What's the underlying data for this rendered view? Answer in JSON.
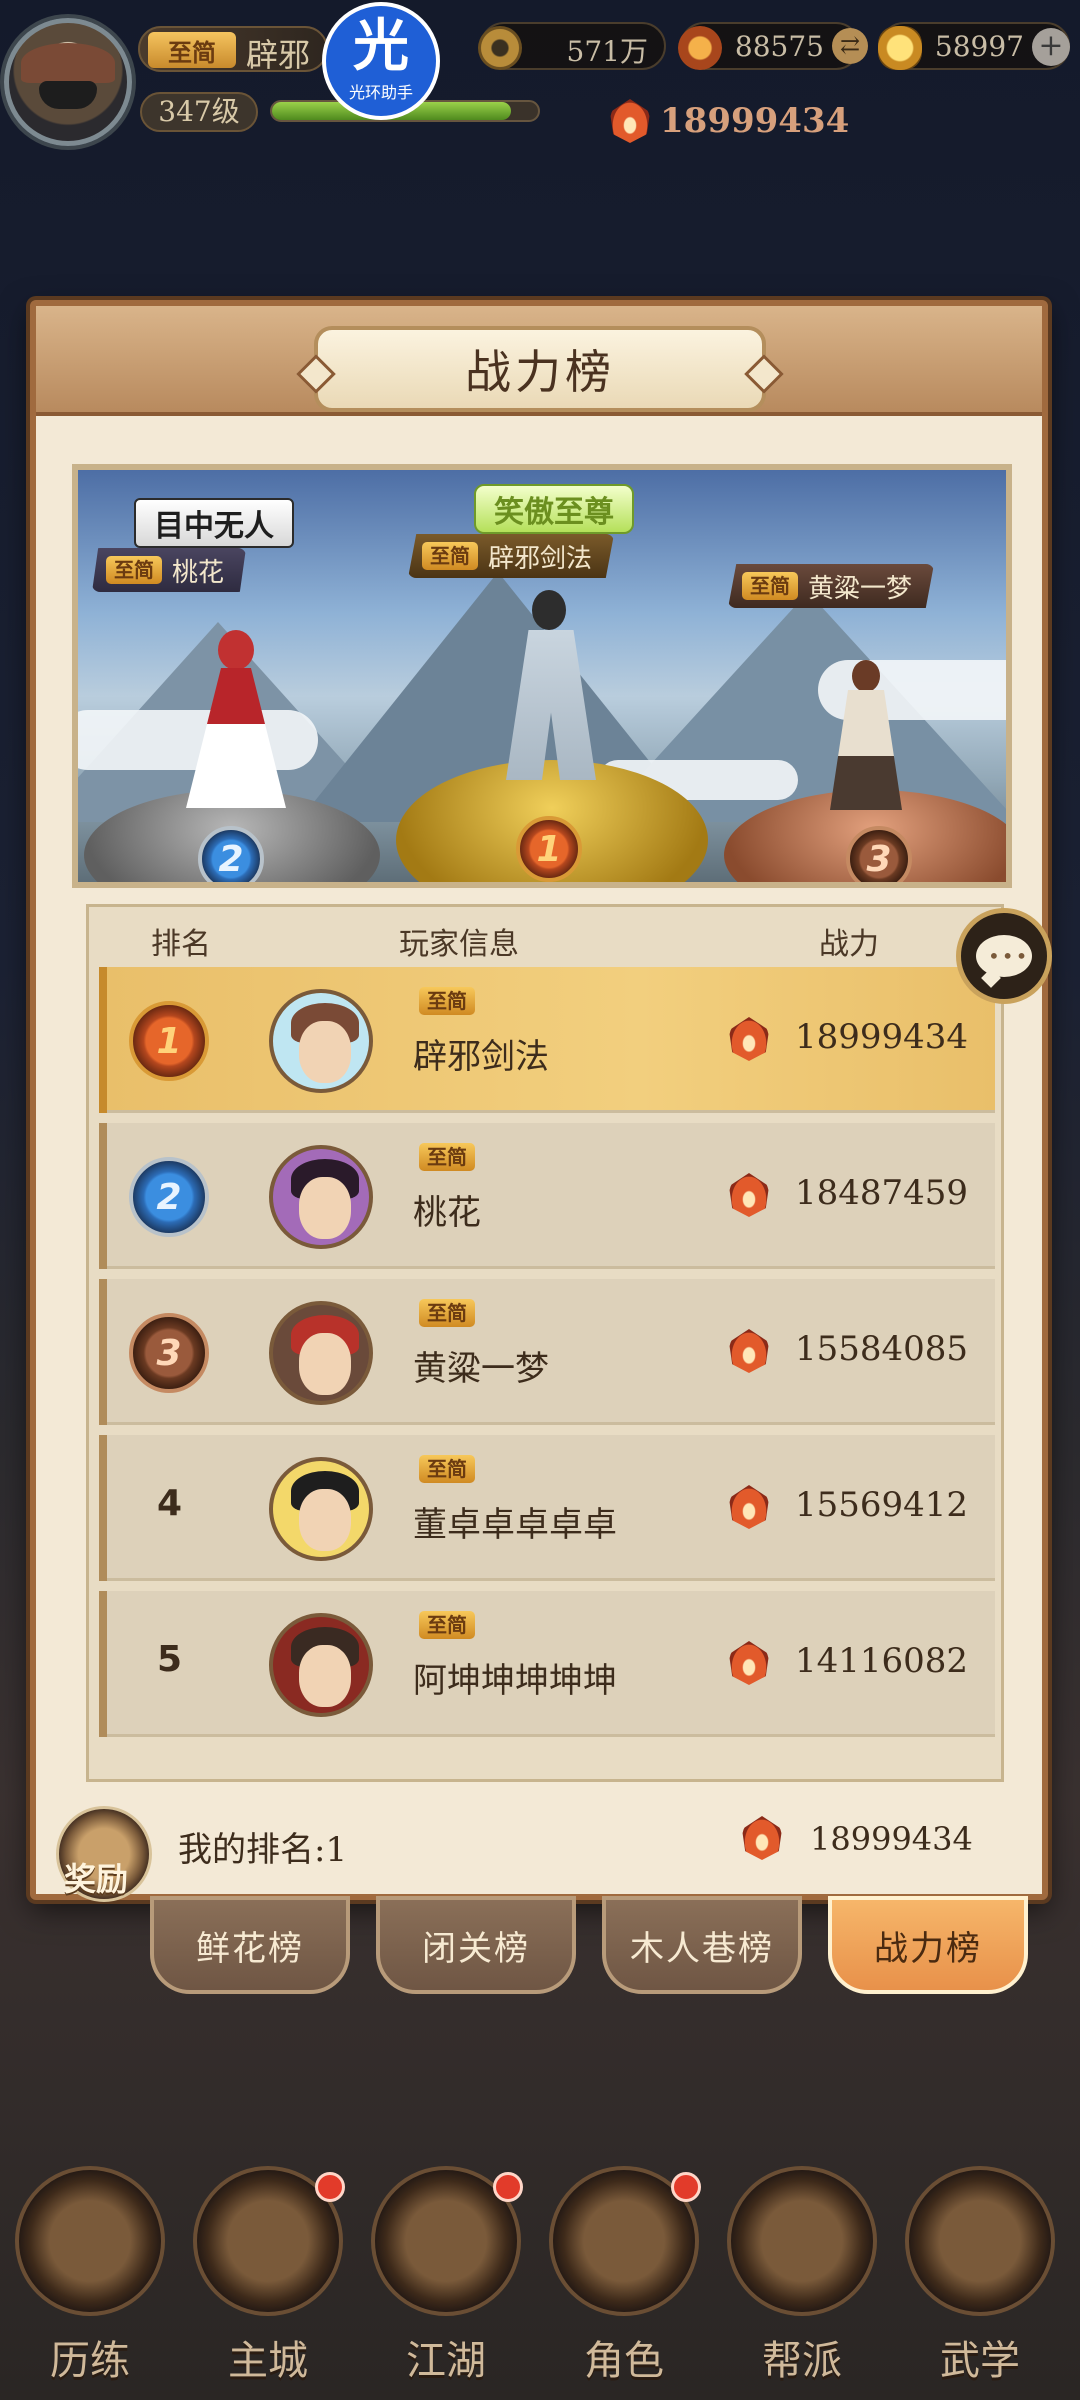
{
  "hud": {
    "vip_tag": "至简",
    "player_name": "辟邪",
    "level": "347级",
    "exp_progress_percent": 90,
    "helper_badge": {
      "glyph": "光",
      "caption": "光环助手"
    },
    "resources": [
      {
        "icon": "copper-coin-icon",
        "value": "571万"
      },
      {
        "icon": "flame-coin-icon",
        "value": "88575"
      },
      {
        "icon": "gold-ingot-icon",
        "value": "58997"
      }
    ],
    "power": "18999434"
  },
  "panel": {
    "title": "战力榜",
    "podium": {
      "title_left": "目中无人",
      "title_mid": "笑傲至尊",
      "first": {
        "tag": "至简",
        "name": "辟邪剑法",
        "rank": "1"
      },
      "second": {
        "tag": "至简",
        "name": "桃花",
        "rank": "2"
      },
      "third": {
        "tag": "至简",
        "name": "黄粱一梦",
        "rank": "3"
      }
    },
    "table": {
      "headers": {
        "rank": "排名",
        "player": "玩家信息",
        "power": "战力"
      },
      "rows": [
        {
          "rank": "1",
          "tag": "至简",
          "name": "辟邪剑法",
          "power": "18999434"
        },
        {
          "rank": "2",
          "tag": "至简",
          "name": "桃花",
          "power": "18487459"
        },
        {
          "rank": "3",
          "tag": "至简",
          "name": "黄粱一梦",
          "power": "15584085"
        },
        {
          "rank": "4",
          "tag": "至简",
          "name": "董卓卓卓卓卓",
          "power": "15569412"
        },
        {
          "rank": "5",
          "tag": "至简",
          "name": "阿坤坤坤坤坤",
          "power": "14116082"
        }
      ]
    },
    "my_rank": {
      "reward_label": "奖励",
      "text": "我的排名:1",
      "power": "18999434"
    }
  },
  "tabs": [
    {
      "label": "鲜花榜",
      "active": false
    },
    {
      "label": "闭关榜",
      "active": false
    },
    {
      "label": "木人巷榜",
      "active": false
    },
    {
      "label": "战力榜",
      "active": true
    }
  ],
  "bottom_nav": [
    {
      "label": "历练",
      "badge": false
    },
    {
      "label": "主城",
      "badge": true
    },
    {
      "label": "江湖",
      "badge": true
    },
    {
      "label": "角色",
      "badge": true
    },
    {
      "label": "帮派",
      "badge": false
    },
    {
      "label": "武学",
      "badge": false
    }
  ],
  "colors": {
    "panel_bg": "#f3e9d6",
    "first_row": "#f2cf7e",
    "active_tab": "#e8914a",
    "notify_dot": "#e23b2a"
  }
}
